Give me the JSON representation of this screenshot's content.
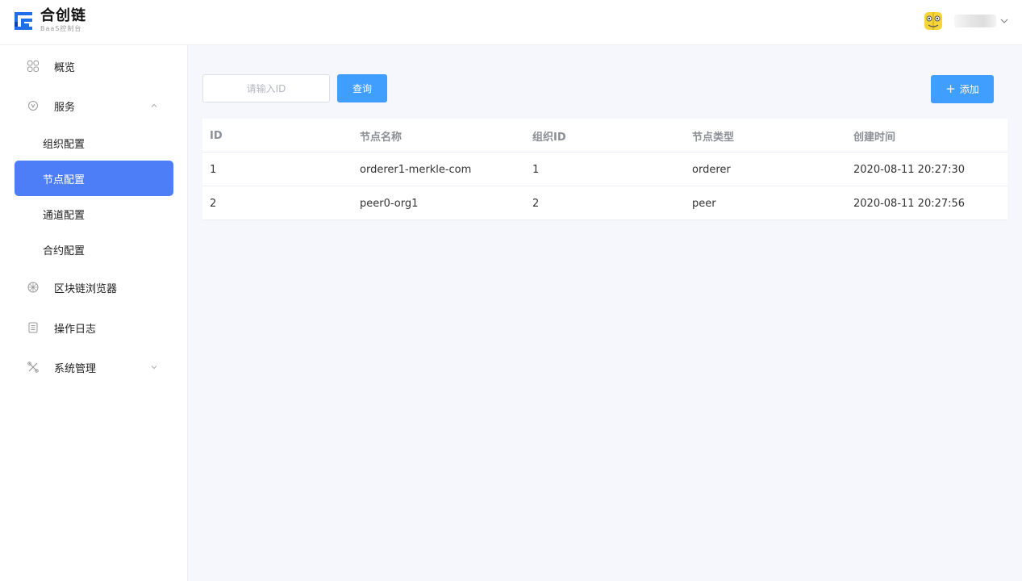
{
  "header": {
    "logo_title": "合创链",
    "logo_subtitle": "BaaS控制台",
    "user_menu_icon": "chevron-down-icon"
  },
  "sidebar": {
    "items": [
      {
        "label": "概览",
        "icon": "dashboard-grid-icon"
      },
      {
        "label": "服务",
        "icon": "service-icon",
        "expanded": true,
        "children": [
          {
            "label": "组织配置",
            "active": false
          },
          {
            "label": "节点配置",
            "active": true
          },
          {
            "label": "通道配置",
            "active": false
          },
          {
            "label": "合约配置",
            "active": false
          }
        ]
      },
      {
        "label": "区块链浏览器",
        "icon": "blockchain-browser-icon"
      },
      {
        "label": "操作日志",
        "icon": "log-icon"
      },
      {
        "label": "系统管理",
        "icon": "system-settings-icon",
        "expanded": false
      }
    ],
    "active_color": "#4d7ef7"
  },
  "toolbar": {
    "search_placeholder": "请输入ID",
    "search_value": "",
    "query_label": "查询",
    "add_label": "添加",
    "button_color": "#409eff"
  },
  "table": {
    "columns": [
      "ID",
      "节点名称",
      "组织ID",
      "节点类型",
      "创建时间"
    ],
    "rows": [
      [
        "1",
        "orderer1-merkle-com",
        "1",
        "orderer",
        "2020-08-11 20:27:30"
      ],
      [
        "2",
        "peer0-org1",
        "2",
        "peer",
        "2020-08-11 20:27:56"
      ]
    ]
  }
}
